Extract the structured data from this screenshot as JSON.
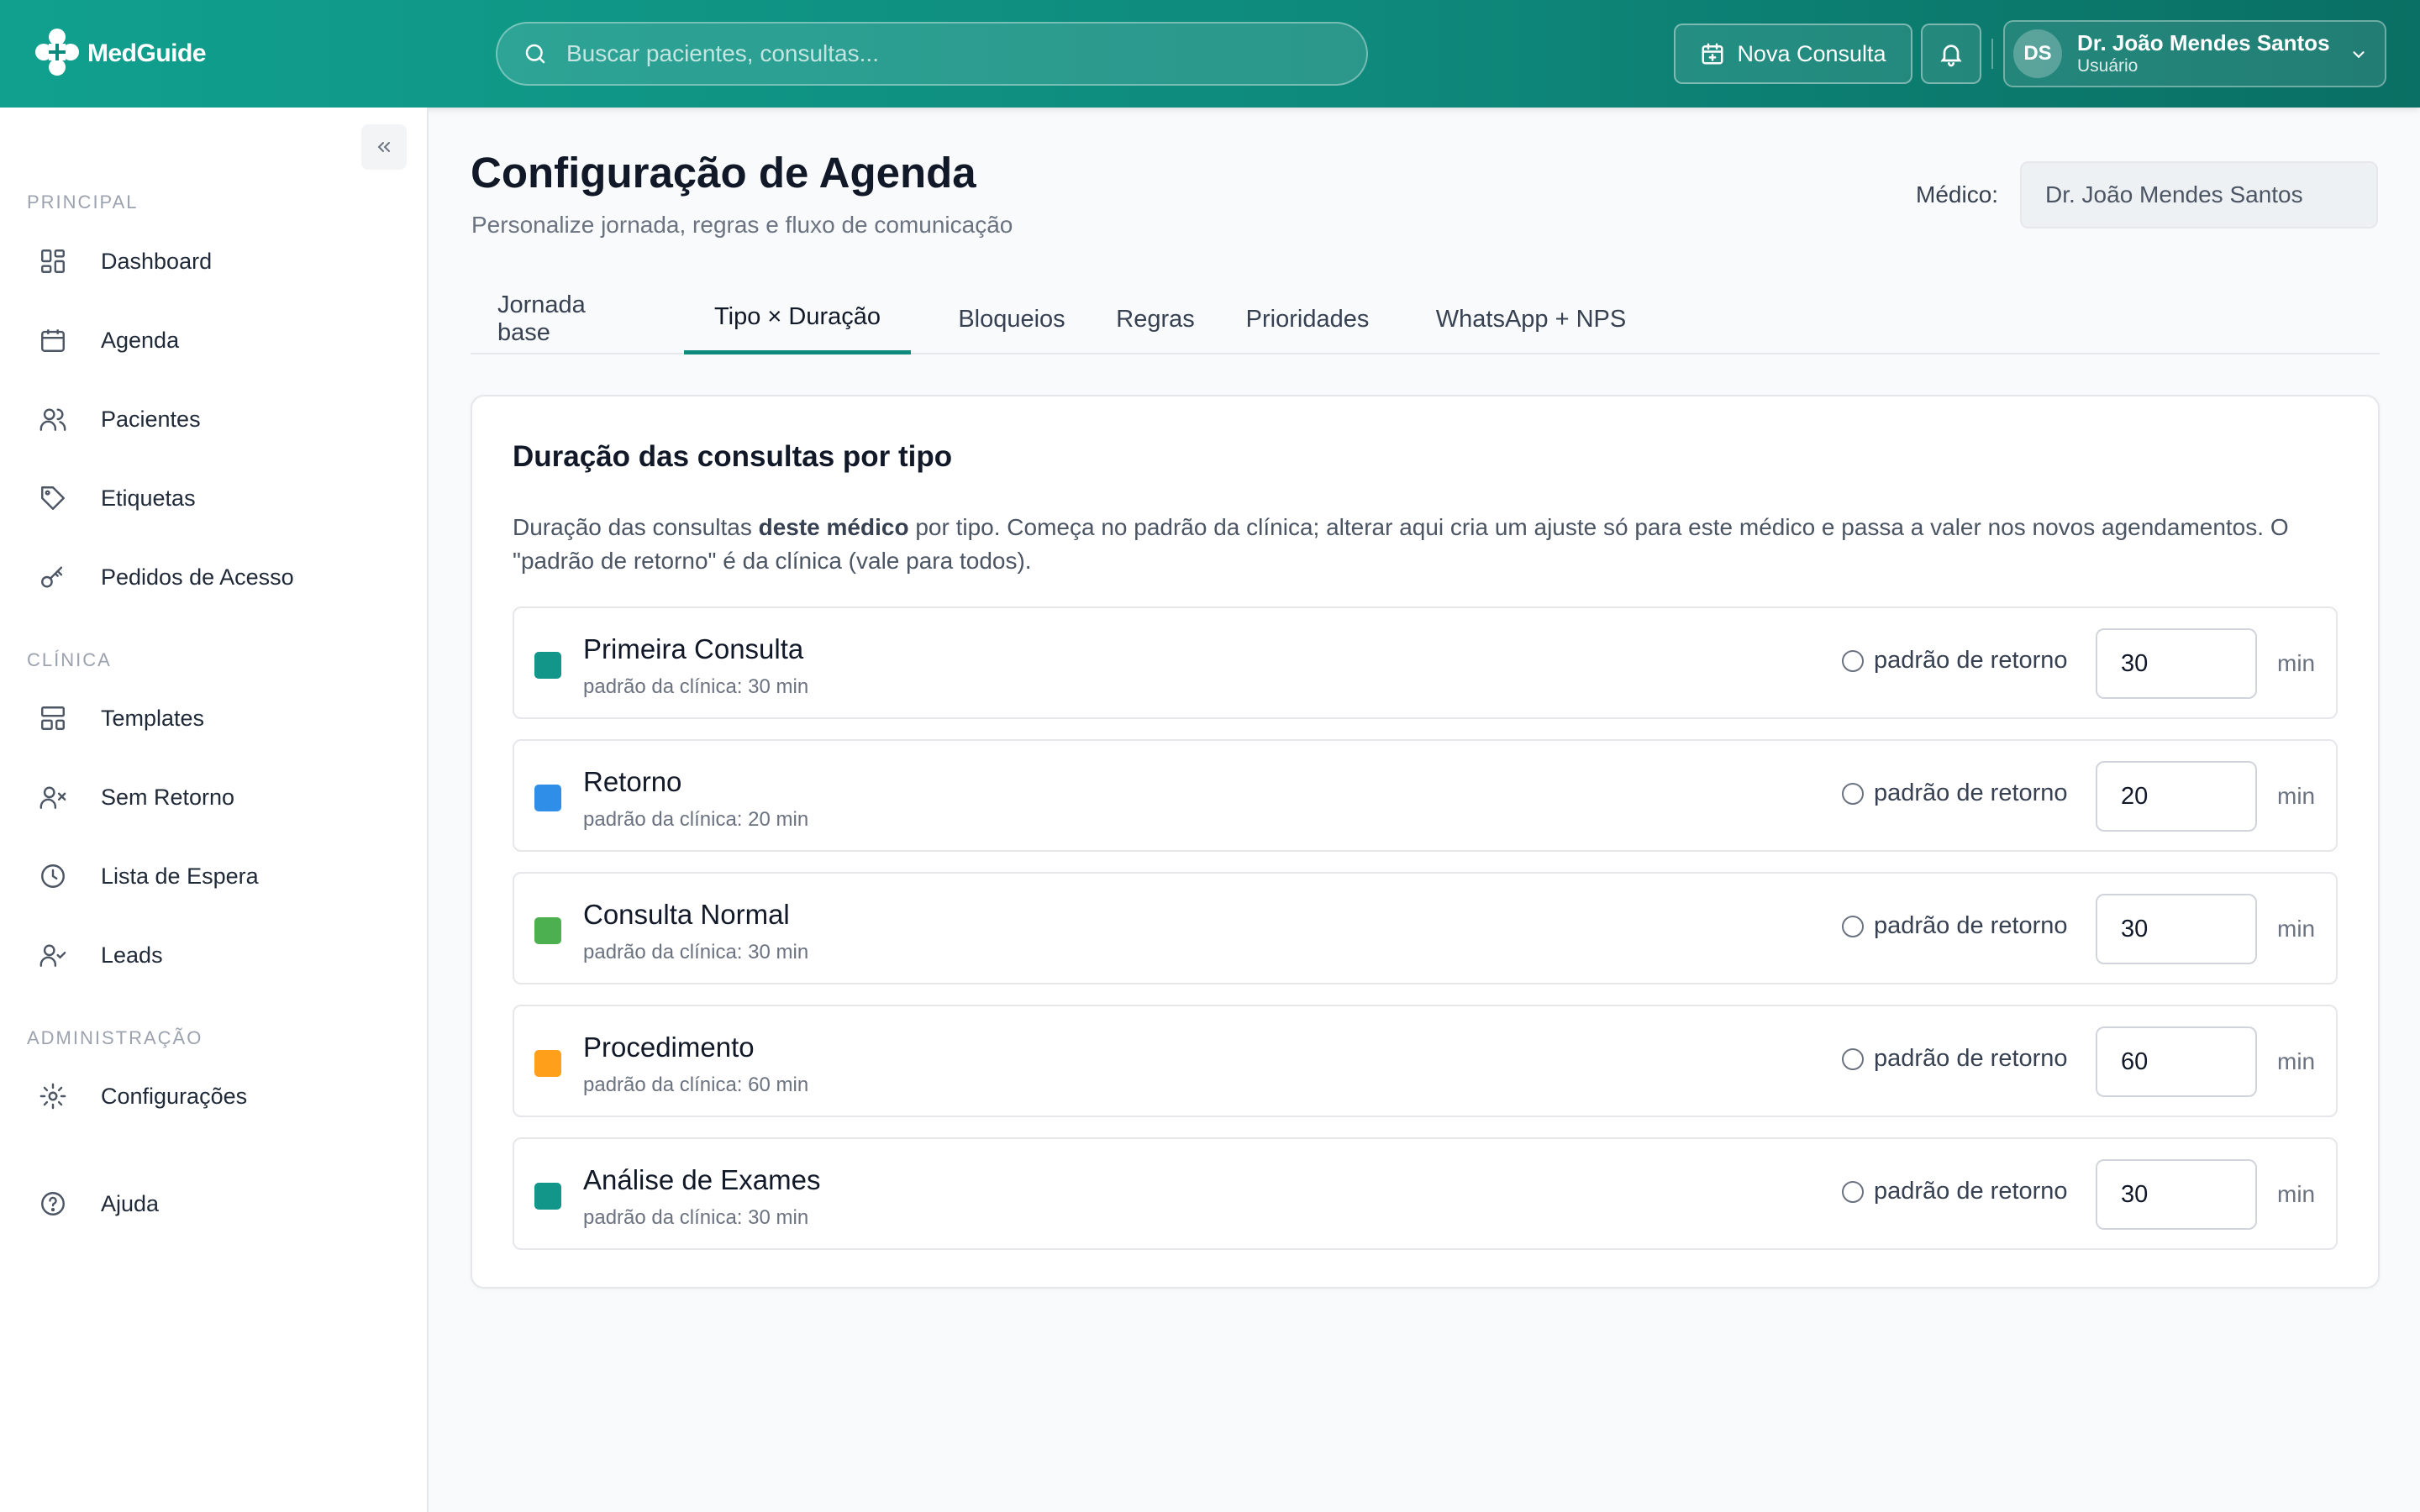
{
  "app": {
    "name": "MedGuide"
  },
  "header": {
    "search_placeholder": "Buscar pacientes, consultas...",
    "new_button_label": "Nova Consulta",
    "user": {
      "initials": "DS",
      "name": "Dr. João Mendes Santos",
      "role": "Usuário"
    }
  },
  "sidebar": {
    "sections": [
      {
        "title": "PRINCIPAL",
        "items": [
          {
            "label": "Dashboard",
            "icon": "dashboard-icon"
          },
          {
            "label": "Agenda",
            "icon": "calendar-icon"
          },
          {
            "label": "Pacientes",
            "icon": "users-icon"
          },
          {
            "label": "Etiquetas",
            "icon": "tag-icon"
          },
          {
            "label": "Pedidos de Acesso",
            "icon": "key-icon"
          }
        ]
      },
      {
        "title": "CLÍNICA",
        "items": [
          {
            "label": "Templates",
            "icon": "layout-icon"
          },
          {
            "label": "Sem Retorno",
            "icon": "user-x-icon"
          },
          {
            "label": "Lista de Espera",
            "icon": "clock-icon"
          },
          {
            "label": "Leads",
            "icon": "user-check-icon"
          }
        ]
      },
      {
        "title": "ADMINISTRAÇÃO",
        "items": [
          {
            "label": "Configurações",
            "icon": "gear-icon"
          }
        ]
      }
    ],
    "help_label": "Ajuda"
  },
  "page": {
    "title": "Configuração de Agenda",
    "subtitle": "Personalize jornada, regras e fluxo de comunicação",
    "medico_label": "Médico:",
    "medico_value": "Dr. João Mendes Santos"
  },
  "tabs": [
    {
      "label": "Jornada base",
      "active": false
    },
    {
      "label": "Tipo × Duração",
      "active": true
    },
    {
      "label": "Bloqueios",
      "active": false
    },
    {
      "label": "Regras",
      "active": false
    },
    {
      "label": "Prioridades",
      "active": false
    },
    {
      "label": "WhatsApp + NPS",
      "active": false
    }
  ],
  "card": {
    "title": "Duração das consultas por tipo",
    "desc_before": "Duração das consultas ",
    "desc_bold": "deste médico",
    "desc_after": " por tipo. Começa no padrão da clínica; alterar aqui cria um ajuste só para este médico e passa a valer nos novos agendamentos. O \"padrão de retorno\" é da clínica (vale para todos).",
    "radio_label": "padrão de retorno",
    "unit": "min",
    "types": [
      {
        "name": "Primeira Consulta",
        "default": "padrão da clínica: 30 min",
        "minutes": "30",
        "color": "#12968a"
      },
      {
        "name": "Retorno",
        "default": "padrão da clínica: 20 min",
        "minutes": "20",
        "color": "#2f8fe8"
      },
      {
        "name": "Consulta Normal",
        "default": "padrão da clínica: 30 min",
        "minutes": "30",
        "color": "#4caf50"
      },
      {
        "name": "Procedimento",
        "default": "padrão da clínica: 60 min",
        "minutes": "60",
        "color": "#ff9f1a"
      },
      {
        "name": "Análise de Exames",
        "default": "padrão da clínica: 30 min",
        "minutes": "30",
        "color": "#12968a"
      }
    ]
  }
}
